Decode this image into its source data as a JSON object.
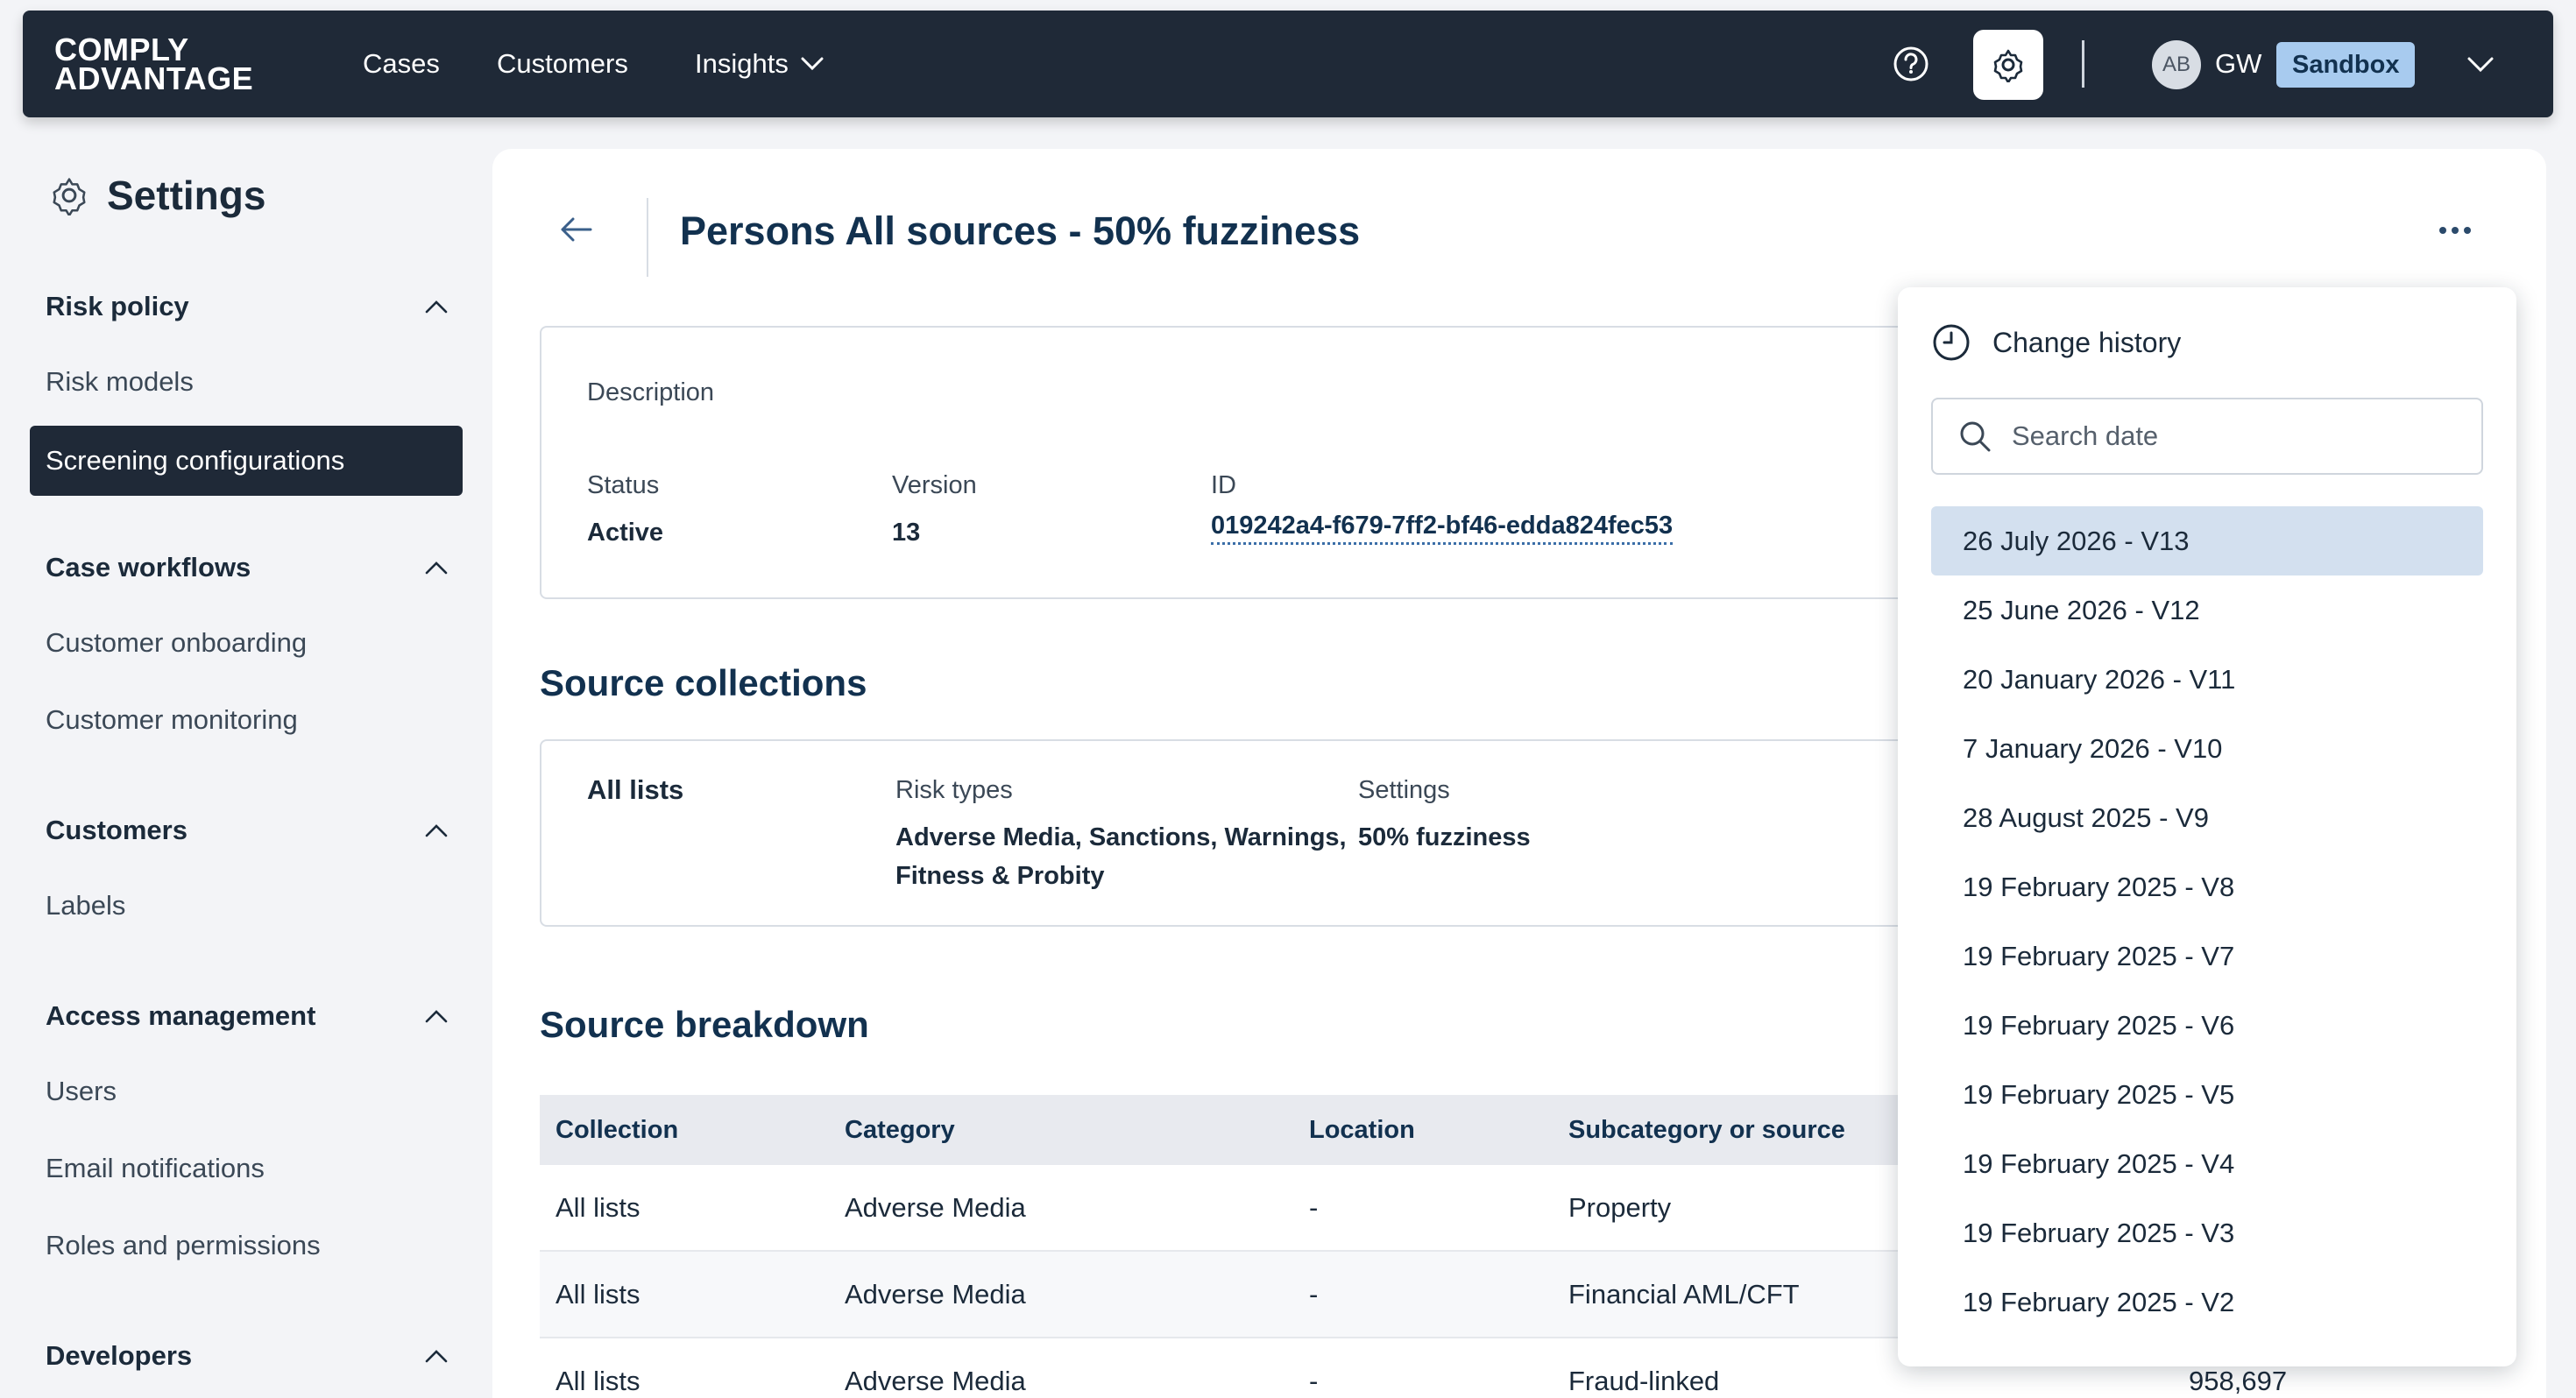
{
  "nav": {
    "logo_line1": "COMPLY",
    "logo_line2": "ADVANTAGE",
    "items": [
      {
        "label": "Cases"
      },
      {
        "label": "Customers"
      },
      {
        "label": "Insights"
      }
    ],
    "user": {
      "avatar": "AB",
      "initials": "GW",
      "environment": "Sandbox"
    }
  },
  "sidebar": {
    "title": "Settings",
    "sections": [
      {
        "label": "Risk policy",
        "items": [
          "Risk models",
          "Screening configurations"
        ]
      },
      {
        "label": "Case workflows",
        "items": [
          "Customer onboarding",
          "Customer monitoring"
        ]
      },
      {
        "label": "Customers",
        "items": [
          "Labels"
        ]
      },
      {
        "label": "Access management",
        "items": [
          "Users",
          "Email notifications",
          "Roles and permissions"
        ]
      },
      {
        "label": "Developers",
        "items": []
      }
    ],
    "active_item": "Screening configurations"
  },
  "page": {
    "title": "Persons All sources - 50% fuzziness",
    "details": {
      "description_label": "Description",
      "status_label": "Status",
      "status_value": "Active",
      "version_label": "Version",
      "version_value": "13",
      "id_label": "ID",
      "id_value": "019242a4-f679-7ff2-bf46-edda824fec53"
    },
    "source_collections": {
      "heading": "Source collections",
      "name": "All lists",
      "risk_types_label": "Risk types",
      "risk_types_line1": "Adverse Media, Sanctions, Warnings,",
      "risk_types_line2": "Fitness & Probity",
      "settings_label": "Settings",
      "settings_value": "50% fuzziness"
    },
    "source_breakdown": {
      "heading": "Source breakdown",
      "columns": [
        "Collection",
        "Category",
        "Location",
        "Subcategory or source"
      ],
      "rows": [
        {
          "collection": "All lists",
          "category": "Adverse Media",
          "location": "-",
          "subcategory": "Property",
          "count": ""
        },
        {
          "collection": "All lists",
          "category": "Adverse Media",
          "location": "-",
          "subcategory": "Financial AML/CFT",
          "count": ""
        },
        {
          "collection": "All lists",
          "category": "Adverse Media",
          "location": "-",
          "subcategory": "Fraud-linked",
          "count": "958,697"
        }
      ]
    }
  },
  "history": {
    "title": "Change history",
    "search_placeholder": "Search date",
    "versions": [
      "26 July 2026 - V13",
      "25 June 2026 - V12",
      "20 January 2026 - V11",
      "7 January 2026 - V10",
      "28 August 2025 - V9",
      "19 February 2025 - V8",
      "19 February 2025 - V7",
      "19 February 2025 - V6",
      "19 February 2025 - V5",
      "19 February 2025 - V4",
      "19 February 2025 - V3",
      "19 February 2025 - V2"
    ],
    "selected_index": 0
  },
  "colors": {
    "nav_bg": "#1f2937",
    "heading": "#12314f",
    "badge_bg": "#a8cbef",
    "selected_row": "#d3e0ef"
  }
}
